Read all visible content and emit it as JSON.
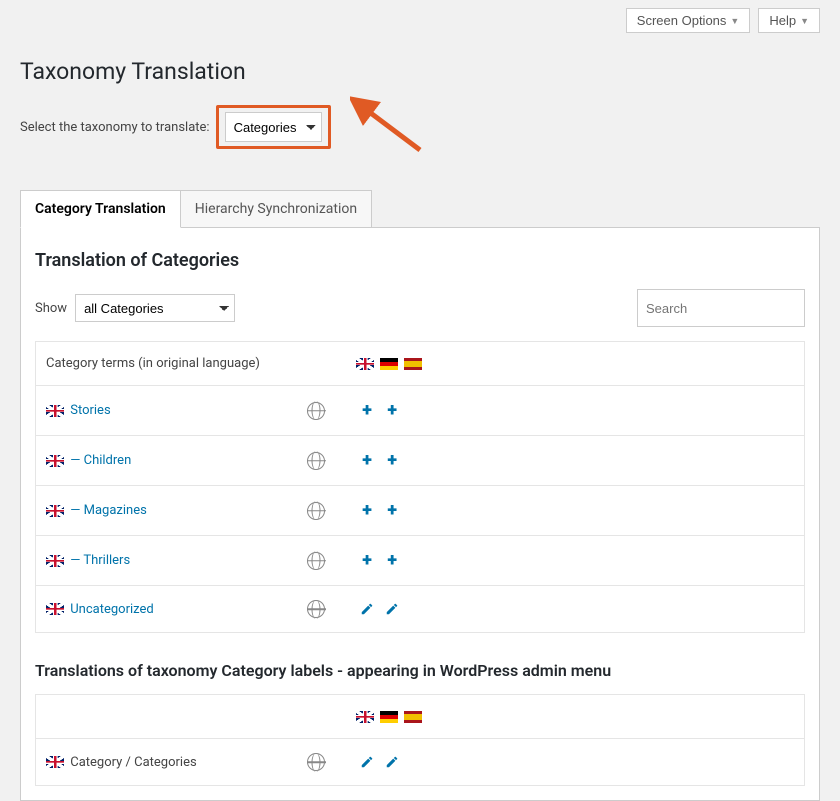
{
  "top": {
    "screen_options": "Screen Options",
    "help": "Help"
  },
  "page_title": "Taxonomy Translation",
  "selector": {
    "label": "Select the taxonomy to translate:",
    "value": "Categories"
  },
  "tabs": [
    {
      "label": "Category Translation",
      "active": true
    },
    {
      "label": "Hierarchy Synchronization",
      "active": false
    }
  ],
  "section_title": "Translation of Categories",
  "filter": {
    "show_label": "Show",
    "value": "all Categories",
    "search_placeholder": "Search"
  },
  "header_col": "Category terms (in original language)",
  "flag_langs": [
    "uk",
    "de",
    "es"
  ],
  "terms": [
    {
      "label": "Stories",
      "actions": [
        "plus",
        "plus"
      ]
    },
    {
      "label": "— Children",
      "actions": [
        "plus",
        "plus"
      ]
    },
    {
      "label": "— Magazines",
      "actions": [
        "plus",
        "plus"
      ]
    },
    {
      "label": "— Thrillers",
      "actions": [
        "plus",
        "plus"
      ]
    },
    {
      "label": "Uncategorized",
      "actions": [
        "pencil",
        "pencil"
      ]
    }
  ],
  "labels_section": {
    "title": "Translations of taxonomy Category labels - appearing in WordPress admin menu",
    "row_label": "Category / Categories",
    "row_actions": [
      "pencil",
      "pencil"
    ]
  }
}
